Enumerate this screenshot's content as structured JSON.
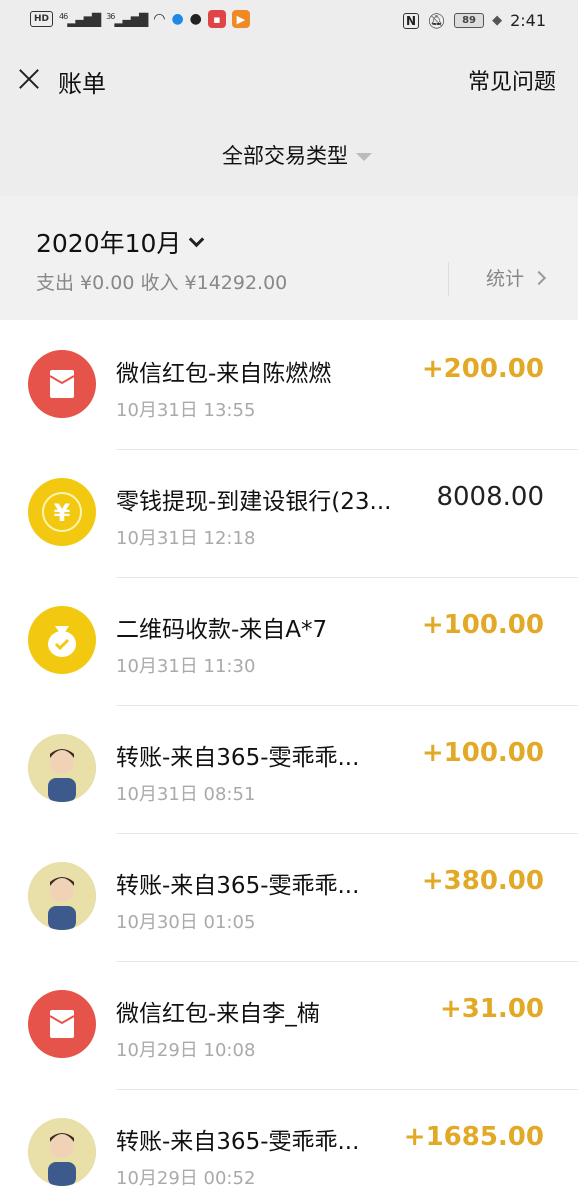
{
  "status_bar": {
    "left_badges": [
      "HD",
      "46",
      "36"
    ],
    "time": "2:41",
    "battery": "89",
    "nfc_symbol": "N"
  },
  "header": {
    "title": "账单",
    "faq_label": "常见问题"
  },
  "filter": {
    "label": "全部交易类型"
  },
  "month": {
    "label": "2020年10月",
    "summary": "支出 ¥0.00 收入 ¥14292.00",
    "stats_label": "统计"
  },
  "colors": {
    "income_amount": "#e2a927",
    "neutral_amount": "#222222",
    "red_packet": "#e5534b",
    "yellow_icon": "#f2c811"
  },
  "transactions": [
    {
      "title": "微信红包-来自陈燃燃",
      "time": "10月31日 13:55",
      "amount": "+200.00",
      "icon": "red-packet-icon"
    },
    {
      "title": "零钱提现-到建设银行(23...",
      "time": "10月31日 12:18",
      "amount": "8008.00",
      "icon": "yuan-coin-icon"
    },
    {
      "title": "二维码收款-来自A*7",
      "time": "10月31日 11:30",
      "amount": "+100.00",
      "icon": "money-bag-icon"
    },
    {
      "title": "转账-来自365-雯乖乖...",
      "time": "10月31日 08:51",
      "amount": "+100.00",
      "icon": "user-avatar"
    },
    {
      "title": "转账-来自365-雯乖乖...",
      "time": "10月30日 01:05",
      "amount": "+380.00",
      "icon": "user-avatar"
    },
    {
      "title": "微信红包-来自李_楠",
      "time": "10月29日 10:08",
      "amount": "+31.00",
      "icon": "red-packet-icon"
    },
    {
      "title": "转账-来自365-雯乖乖...",
      "time": "10月29日 00:52",
      "amount": "+1685.00",
      "icon": "user-avatar"
    }
  ]
}
